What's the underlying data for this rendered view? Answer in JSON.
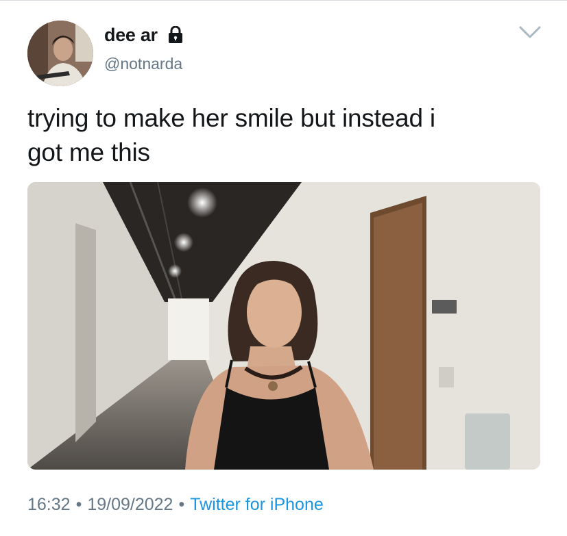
{
  "tweet": {
    "author": {
      "display_name": "dee ar",
      "handle": "@notnarda",
      "protected_icon": "lock-icon",
      "avatar_icon": "avatar-photo"
    },
    "text_line_1": "trying to make her smile but instead i",
    "text_line_2": "got me this",
    "media_icon": "photo-hallway-woman",
    "time": "16:32",
    "separator": "•",
    "date": "19/09/2022",
    "source": "Twitter for iPhone",
    "menu_icon": "chevron-down-icon"
  },
  "colors": {
    "text": "#14171a",
    "secondary": "#657786",
    "link": "#1b95e0"
  }
}
